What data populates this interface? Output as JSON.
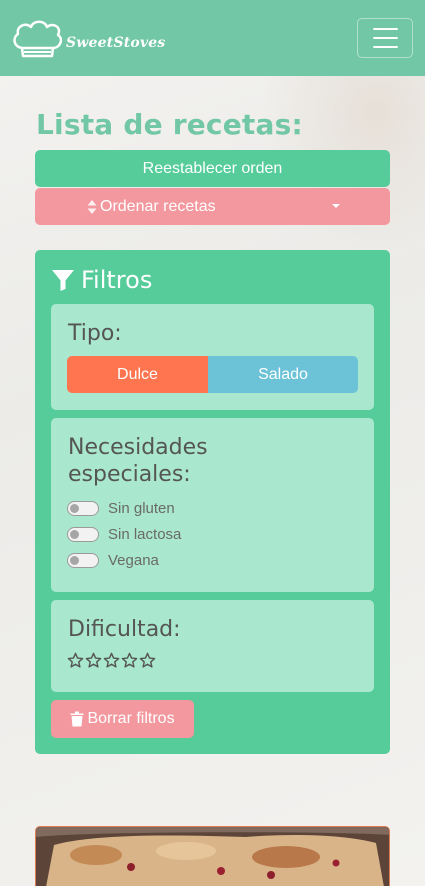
{
  "navbar": {
    "brand": "SweetStoves",
    "menu_icon": "hamburger-icon",
    "bg_color": "#72c7a6"
  },
  "page": {
    "title": "Lista de recetas:"
  },
  "controls": {
    "reset_label": "Reestablecer orden",
    "sort_label": "Ordenar recetas",
    "sort_icon": "sort-icon",
    "reset_color": "#55cc99",
    "sort_color": "#f2989e"
  },
  "filters": {
    "title": "Filtros",
    "icon": "filter-icon",
    "tipo": {
      "title": "Tipo:",
      "options": [
        "Dulce",
        "Salado"
      ],
      "colors": [
        "#ff7550",
        "#6cc2d6"
      ]
    },
    "necesidades": {
      "title_line1": "Necesidades",
      "title_line2": "especiales:",
      "options": [
        "Sin gluten",
        "Sin lactosa",
        "Vegana"
      ]
    },
    "dificultad": {
      "title": "Dificultad:",
      "rating": 0,
      "max_rating": 5
    },
    "clear_label": "Borrar filtros",
    "clear_icon": "trash-icon"
  }
}
